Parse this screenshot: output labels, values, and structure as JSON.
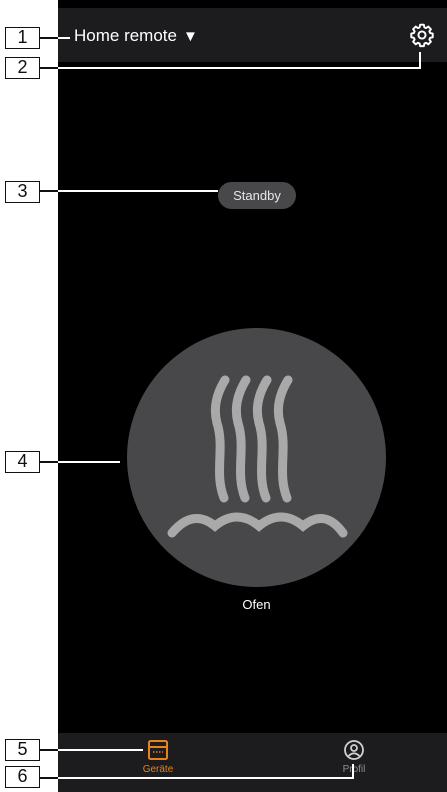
{
  "callouts": [
    "1",
    "2",
    "3",
    "4",
    "5",
    "6"
  ],
  "header": {
    "home_name": "Home remote",
    "dropdown_glyph": "▼",
    "settings_icon": "gear-icon"
  },
  "status": {
    "label": "Standby"
  },
  "device": {
    "name": "Ofen",
    "icon": "oven-heat-icon"
  },
  "bottom_nav": {
    "items": [
      {
        "label": "Geräte",
        "icon": "device-icon",
        "active": true,
        "color": "#e8821e"
      },
      {
        "label": "Profil",
        "icon": "profile-icon",
        "active": false,
        "color": "#8e8e93"
      }
    ]
  },
  "colors": {
    "background": "#000000",
    "bar": "#1c1c1e",
    "circle": "#48484a",
    "accent": "#e8821e"
  }
}
